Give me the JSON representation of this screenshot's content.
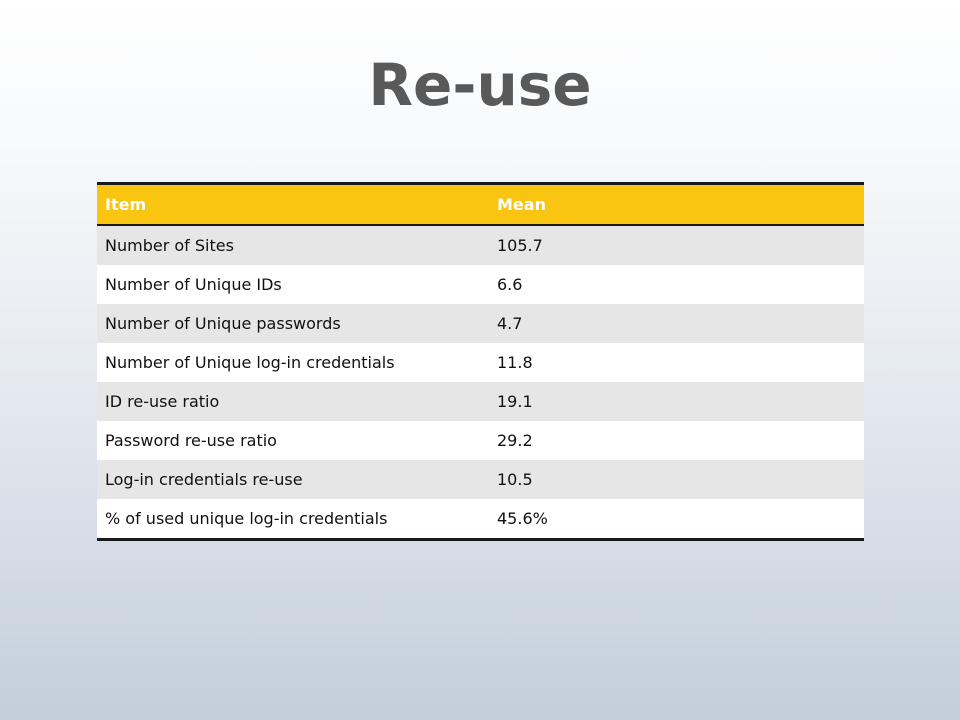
{
  "slide": {
    "title": "Re-use"
  },
  "table": {
    "headers": [
      "Item",
      "Mean"
    ],
    "rows": [
      [
        "Number of Sites",
        "105.7"
      ],
      [
        "Number of Unique IDs",
        "6.6"
      ],
      [
        "Number of Unique passwords",
        "4.7"
      ],
      [
        "Number of Unique log-in credentials",
        "11.8"
      ],
      [
        "ID re-use ratio",
        "19.1"
      ],
      [
        "Password re-use ratio",
        "29.2"
      ],
      [
        "Log-in credentials re-use",
        "10.5"
      ],
      [
        "% of used unique log-in credentials",
        "45.6%"
      ]
    ]
  },
  "colors": {
    "header_background": "#f9c511",
    "title_text": "#595959",
    "row_stripe": "#e6e6e6"
  }
}
